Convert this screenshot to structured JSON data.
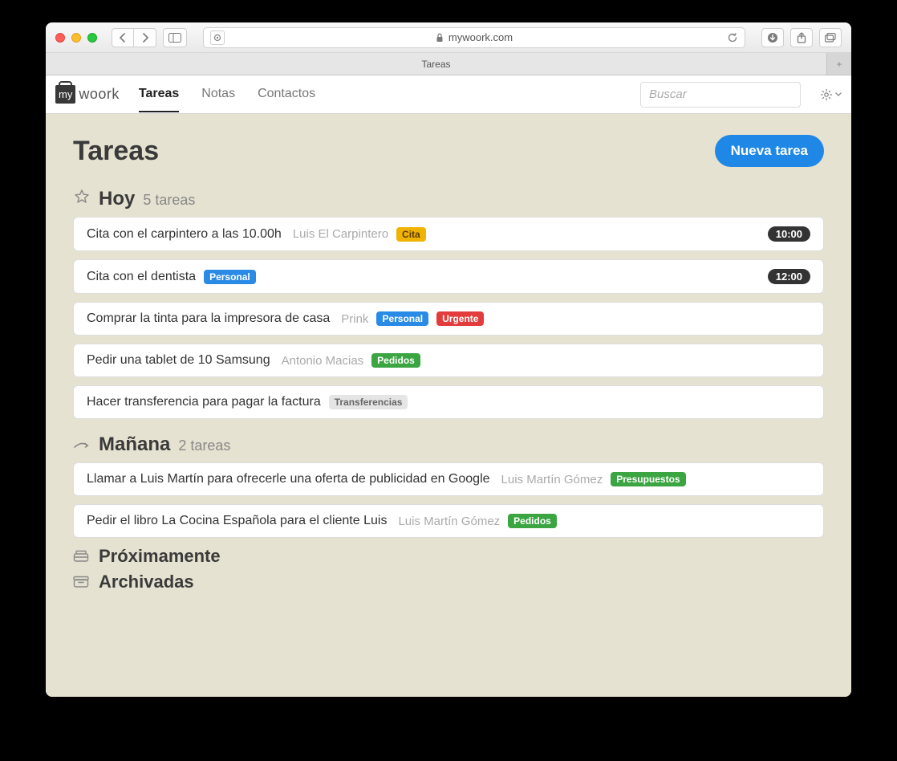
{
  "browser": {
    "url": "mywoork.com",
    "tab_title": "Tareas"
  },
  "app": {
    "logo": {
      "my": "my",
      "woork": "woork"
    },
    "nav": {
      "tareas": "Tareas",
      "notas": "Notas",
      "contactos": "Contactos"
    },
    "search_placeholder": "Buscar"
  },
  "page": {
    "title": "Tareas",
    "new_task_btn": "Nueva tarea"
  },
  "sections": {
    "hoy": {
      "title": "Hoy",
      "count": "5 tareas",
      "tasks": [
        {
          "title": "Cita con el carpintero a las 10.00h",
          "meta": "Luis El Carpintero",
          "badges": [
            {
              "text": "Cita",
              "cls": "cita"
            }
          ],
          "time": "10:00"
        },
        {
          "title": "Cita con el dentista",
          "meta": "",
          "badges": [
            {
              "text": "Personal",
              "cls": "personal"
            }
          ],
          "time": "12:00"
        },
        {
          "title": "Comprar la tinta para la impresora de casa",
          "meta": "Prink",
          "badges": [
            {
              "text": "Personal",
              "cls": "personal"
            },
            {
              "text": "Urgente",
              "cls": "urgente"
            }
          ],
          "time": ""
        },
        {
          "title": "Pedir una tablet de 10 Samsung",
          "meta": "Antonio Macias",
          "badges": [
            {
              "text": "Pedidos",
              "cls": "pedidos"
            }
          ],
          "time": ""
        },
        {
          "title": "Hacer transferencia para pagar la factura",
          "meta": "",
          "badges": [
            {
              "text": "Transferencias",
              "cls": "transferencias"
            }
          ],
          "time": ""
        }
      ]
    },
    "manana": {
      "title": "Mañana",
      "count": "2 tareas",
      "tasks": [
        {
          "title": "Llamar a Luis Martín para ofrecerle una oferta de publicidad en Google",
          "meta": "Luis Martín Gómez",
          "badges": [
            {
              "text": "Presupuestos",
              "cls": "presupuestos"
            }
          ],
          "time": ""
        },
        {
          "title": "Pedir el libro La Cocina Española para el cliente Luis",
          "meta": "Luis Martín Gómez",
          "badges": [
            {
              "text": "Pedidos",
              "cls": "pedidos"
            }
          ],
          "time": ""
        }
      ]
    },
    "proximamente": {
      "title": "Próximamente"
    },
    "archivadas": {
      "title": "Archivadas"
    }
  }
}
